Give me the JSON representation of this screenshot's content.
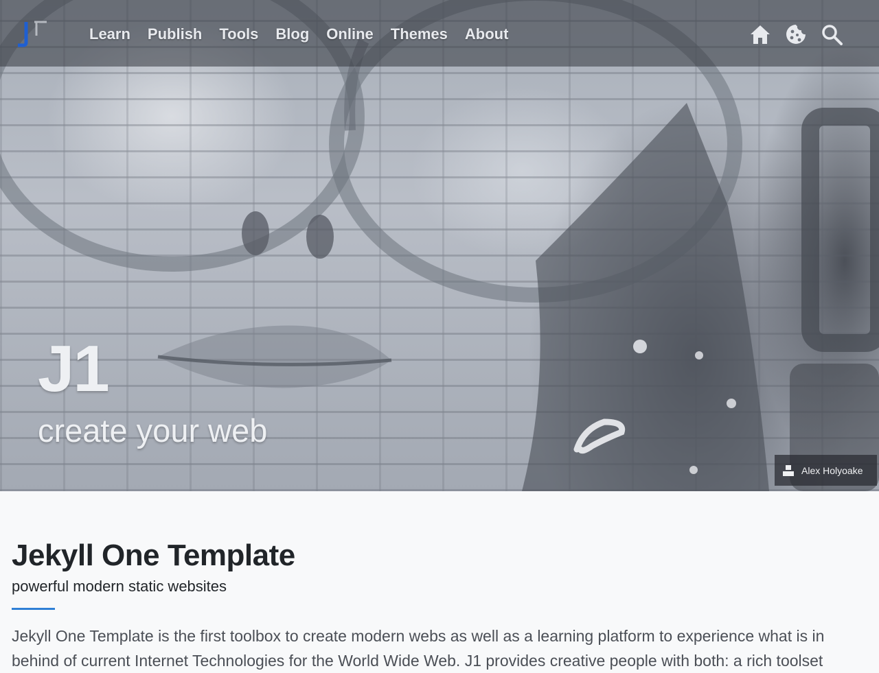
{
  "nav": {
    "items": [
      {
        "label": "Learn"
      },
      {
        "label": "Publish"
      },
      {
        "label": "Tools"
      },
      {
        "label": "Blog"
      },
      {
        "label": "Online"
      },
      {
        "label": "Themes"
      },
      {
        "label": "About"
      }
    ],
    "icons": [
      "home-icon",
      "cookie-icon",
      "search-icon"
    ]
  },
  "hero": {
    "title": "J1",
    "tagline": "create your web",
    "credit": "Alex Holyoake"
  },
  "content": {
    "title": "Jekyll One Template",
    "subtitle": "powerful modern static websites",
    "lead": "Jekyll One Template is the first toolbox to create modern webs as well as a learning platform to experience what is in behind of current Internet Technologies for the World Wide Web. J1 provides creative people with both: a rich toolset"
  },
  "colors": {
    "accent": "#2f80d6",
    "logo_blue": "#1f5fd1",
    "navbar": "#343840"
  }
}
